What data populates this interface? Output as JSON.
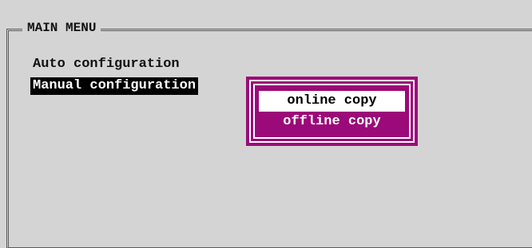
{
  "menu": {
    "title": "MAIN MENU",
    "items": [
      {
        "label": "Auto configuration",
        "selected": false
      },
      {
        "label": "Manual configuration",
        "selected": true
      }
    ]
  },
  "popup": {
    "options": [
      {
        "label": "online copy",
        "highlighted": true
      },
      {
        "label": "offline copy",
        "highlighted": false
      }
    ]
  },
  "colors": {
    "background": "#d4d4d4",
    "frame": "#5a5a5a",
    "selection": "#000000",
    "popup": "#9b0a78",
    "popup_highlight": "#ffffff"
  }
}
